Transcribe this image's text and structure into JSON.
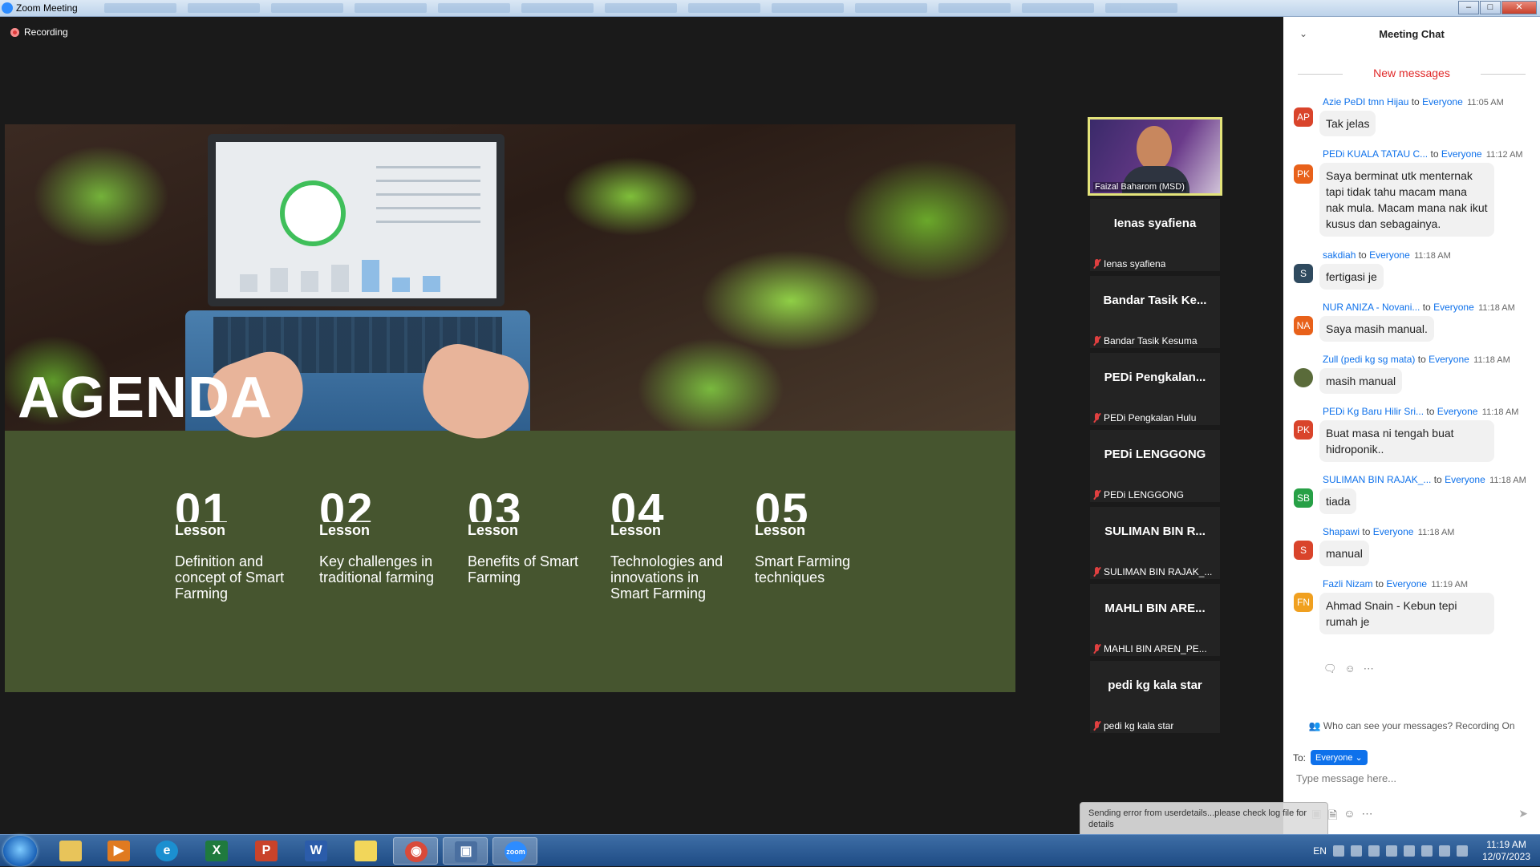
{
  "window": {
    "title": "Zoom Meeting",
    "buttons": [
      "–",
      "□",
      "✕"
    ]
  },
  "meeting": {
    "recording_label": "Recording"
  },
  "slide": {
    "title": "AGENDA",
    "lessons": [
      {
        "number": "01",
        "label": "Lesson",
        "text": "Definition and concept of Smart Farming"
      },
      {
        "number": "02",
        "label": "Lesson",
        "text": "Key challenges in traditional farming"
      },
      {
        "number": "03",
        "label": "Lesson",
        "text": "Benefits of Smart Farming"
      },
      {
        "number": "04",
        "label": "Lesson",
        "text": "Technologies and innovations in Smart Farming"
      },
      {
        "number": "05",
        "label": "Lesson",
        "text": "Smart Farming techniques"
      }
    ]
  },
  "participants": {
    "active_speaker": "Faizal Baharom (MSD)",
    "tiles": [
      {
        "display": "Ienas syafiena",
        "name": "Ienas syafiena"
      },
      {
        "display": "Bandar Tasik Ke...",
        "name": "Bandar Tasik Kesuma"
      },
      {
        "display": "PEDi Pengkalan...",
        "name": "PEDi Pengkalan Hulu"
      },
      {
        "display": "PEDi LENGGONG",
        "name": "PEDi LENGGONG"
      },
      {
        "display": "SULIMAN BIN R...",
        "name": "SULIMAN BIN RAJAK_..."
      },
      {
        "display": "MAHLI BIN ARE...",
        "name": "MAHLI BIN AREN_PE..."
      },
      {
        "display": "pedi kg kala star",
        "name": "pedi kg kala star"
      }
    ]
  },
  "chat": {
    "title": "Meeting Chat",
    "new_messages": "New messages",
    "to_word": "to",
    "messages": [
      {
        "initials": "AP",
        "color": "#d9442b",
        "sender": "Azie PeDI tmn Hijau",
        "recipient": "Everyone",
        "time": "11:05 AM",
        "text": "Tak jelas"
      },
      {
        "initials": "PK",
        "color": "#e8611a",
        "sender": "PEDi KUALA TATAU C...",
        "recipient": "Everyone",
        "time": "11:12 AM",
        "text": "Saya berminat utk menternak tapi tidak tahu macam mana nak mula. Macam mana nak ikut kusus dan sebagainya."
      },
      {
        "initials": "S",
        "color": "#2f4a5f",
        "sender": "sakdiah",
        "recipient": "Everyone",
        "time": "11:18 AM",
        "text": "fertigasi je"
      },
      {
        "initials": "NA",
        "color": "#e8611a",
        "sender": "NUR ANIZA - Novani...",
        "recipient": "Everyone",
        "time": "11:18 AM",
        "text": "Saya masih manual."
      },
      {
        "initials": "",
        "color": "#5a6b3a",
        "sender": "Zull (pedi kg sg mata)",
        "recipient": "Everyone",
        "time": "11:18 AM",
        "text": "masih manual"
      },
      {
        "initials": "PK",
        "color": "#d9442b",
        "sender": "PEDi Kg Baru Hilir Sri...",
        "recipient": "Everyone",
        "time": "11:18 AM",
        "text": "Buat masa ni tengah buat hidroponik.."
      },
      {
        "initials": "SB",
        "color": "#27a046",
        "sender": "SULIMAN BIN RAJAK_...",
        "recipient": "Everyone",
        "time": "11:18 AM",
        "text": "tiada"
      },
      {
        "initials": "S",
        "color": "#d9442b",
        "sender": "Shapawi",
        "recipient": "Everyone",
        "time": "11:18 AM",
        "text": "manual"
      },
      {
        "initials": "FN",
        "color": "#f0a020",
        "sender": "Fazli Nizam",
        "recipient": "Everyone",
        "time": "11:19 AM",
        "text": "Ahmad Snain - Kebun tepi rumah je"
      }
    ],
    "privacy_note": "Who can see your messages? Recording On",
    "to_label": "To:",
    "to_value": "Everyone",
    "placeholder": "Type message here..."
  },
  "toast": "Sending error from userdetails...please check log file for details",
  "taskbar": {
    "language": "EN",
    "time": "11:19 AM",
    "date": "12/07/2023",
    "apps": [
      {
        "name": "folder",
        "glyph": "",
        "color": "#e8c45a"
      },
      {
        "name": "media-player",
        "glyph": "▶",
        "color": "#e07a20"
      },
      {
        "name": "edge",
        "glyph": "e",
        "color": "#1b8fd0"
      },
      {
        "name": "excel",
        "glyph": "X",
        "color": "#1f7a3e"
      },
      {
        "name": "powerpoint",
        "glyph": "P",
        "color": "#c9432a"
      },
      {
        "name": "word",
        "glyph": "W",
        "color": "#2b5caa"
      },
      {
        "name": "sticky-notes",
        "glyph": "",
        "color": "#f2d65a"
      },
      {
        "name": "chrome",
        "glyph": "◉",
        "color": "#d94a3a"
      },
      {
        "name": "remote-desktop",
        "glyph": "▣",
        "color": "#4a6fa0"
      },
      {
        "name": "zoom",
        "glyph": "zoom",
        "color": "#2d8cff"
      }
    ]
  }
}
